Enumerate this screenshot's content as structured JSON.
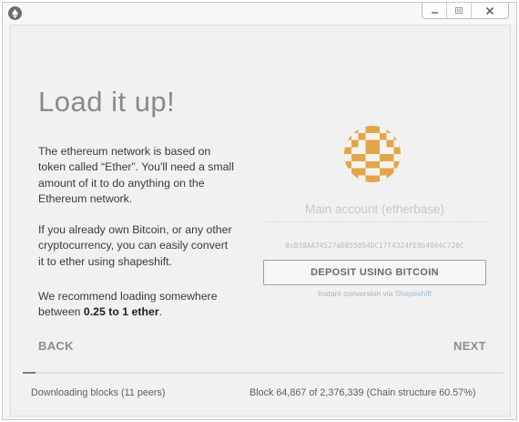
{
  "window": {
    "app_icon": "ethereum-icon",
    "controls": [
      "minimize-icon",
      "maximize-icon",
      "close-icon"
    ]
  },
  "onboarding": {
    "heading": "Load it up!",
    "paragraph_1": "The ethereum network is based on token called “Ether”. You'll need a small amount of it to do anything on the Ethereum network.",
    "paragraph_2": "If you already own Bitcoin, or any other cryptocurrency, you can easily convert it to ether using shapeshift.",
    "paragraph_3_prefix": "We recommend loading somewhere between ",
    "paragraph_3_bold": "0.25 to 1 ether",
    "paragraph_3_suffix": "."
  },
  "account": {
    "identicon": "account-identicon",
    "name": "Main account (etherbase)",
    "address": "0xB38AA74527aD855054DC17f4324FE9b4004C720C",
    "deposit_button": "DEPOSIT USING BITCOIN",
    "conversion_prefix": "Instant conversion via ",
    "conversion_link": "Shapeshift"
  },
  "nav": {
    "back": "BACK",
    "next": "NEXT"
  },
  "status": {
    "sync_progress_fraction": 0.0273,
    "downloading": "Downloading blocks (11 peers)",
    "block_info": "Block 64,867 of 2,376,339 (Chain structure 60.57%)"
  },
  "colors": {
    "identicon_orange": "#e3a54a",
    "identicon_light": "#f6f2ee",
    "text_dark": "#3a3a3a",
    "text_muted": "#8e8e8e"
  }
}
